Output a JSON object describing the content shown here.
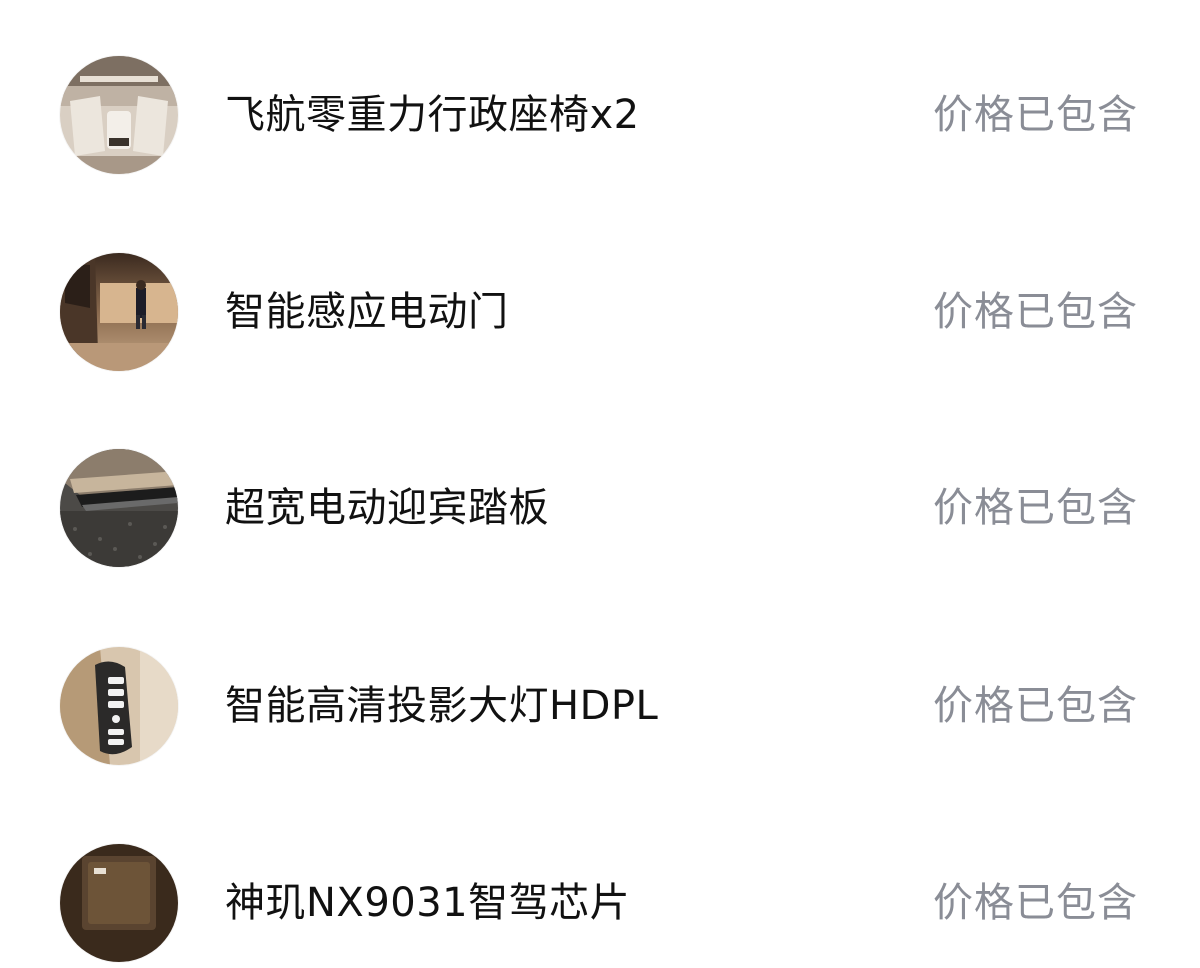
{
  "items": [
    {
      "title": "飞航零重力行政座椅x2",
      "status": "价格已包含",
      "image": "rear-executive-seats-photo"
    },
    {
      "title": "智能感应电动门",
      "status": "价格已包含",
      "image": "electric-door-photo"
    },
    {
      "title": "超宽电动迎宾踏板",
      "status": "价格已包含",
      "image": "running-board-photo"
    },
    {
      "title": "智能高清投影大灯HDPL",
      "status": "价格已包含",
      "image": "headlight-photo"
    },
    {
      "title": "神玑NX9031智驾芯片",
      "status": "价格已包含",
      "image": "chip-photo"
    }
  ],
  "colors": {
    "title": "#111111",
    "status": "#8a8d96",
    "background": "#ffffff"
  }
}
